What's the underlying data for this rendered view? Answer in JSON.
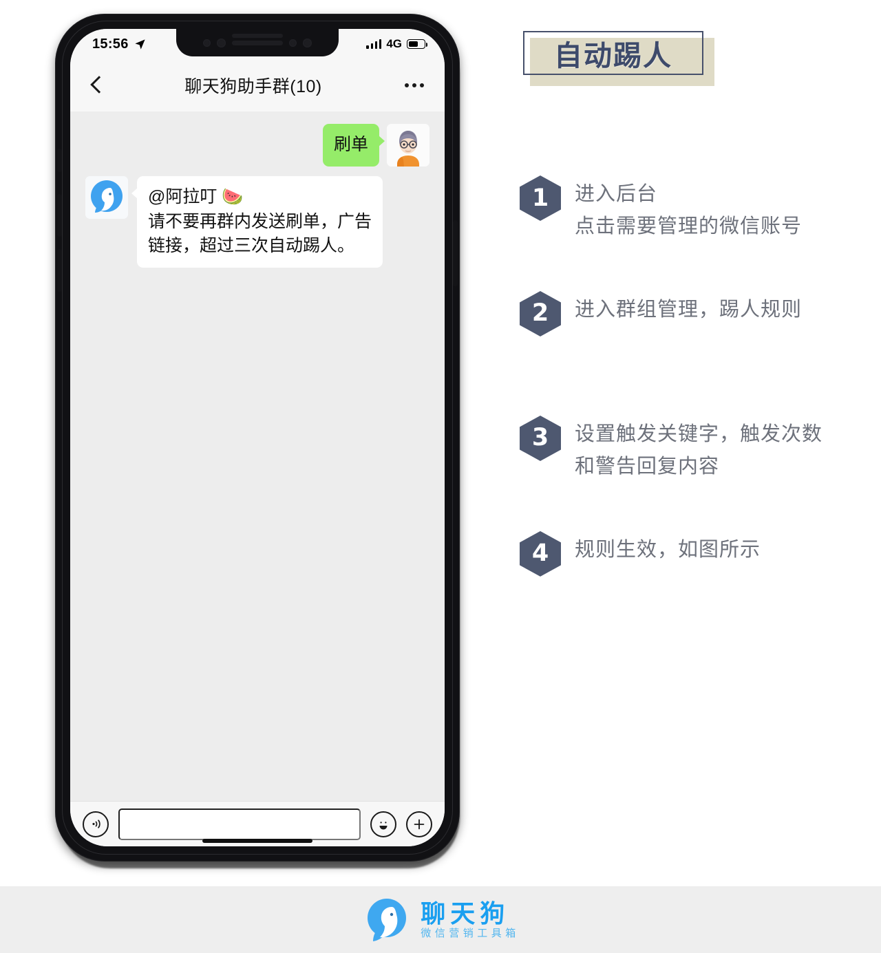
{
  "phone": {
    "status_bar": {
      "time": "15:56",
      "location_icon": "location-arrow-icon",
      "signal_icon": "signal-bars-icon",
      "network": "4G",
      "battery_icon": "battery-icon"
    },
    "header": {
      "back_icon": "back-chevron-icon",
      "title": "聊天狗助手群(10)",
      "more_icon": "more-dots-icon"
    },
    "messages": [
      {
        "direction": "outgoing",
        "text": "刷单",
        "avatar": "user-avatar",
        "bubble_color": "#95ec69"
      },
      {
        "direction": "incoming",
        "line1": "@阿拉叮 🍉",
        "line2": "请不要再群内发送刷单，广告",
        "line3": "链接，超过三次自动踢人。",
        "avatar": "bot-avatar",
        "bubble_color": "#ffffff"
      }
    ],
    "input_bar": {
      "voice_icon": "voice-input-icon",
      "input_value": "",
      "input_placeholder": "",
      "emoji_icon": "emoji-smile-icon",
      "plus_icon": "plus-more-icon"
    }
  },
  "instructions": {
    "title": "自动踢人",
    "title_colors": {
      "text": "#3d4a6b",
      "background": "#dfdbc6",
      "border": "#46506b"
    },
    "badge_color": "#4e5870",
    "steps": [
      {
        "number": "1",
        "lines": [
          "进入后台",
          "点击需要管理的微信账号"
        ]
      },
      {
        "number": "2",
        "lines": [
          "进入群组管理，踢人规则"
        ]
      },
      {
        "number": "3",
        "lines": [
          "设置触发关键字，触发次数",
          "和警告回复内容"
        ]
      },
      {
        "number": "4",
        "lines": [
          "规则生效，如图所示"
        ]
      }
    ]
  },
  "footer": {
    "logo_icon": "chat-dog-logo-icon",
    "brand": "聊天狗",
    "tagline": "微信营销工具箱",
    "brand_color": "#1a9ff0"
  }
}
